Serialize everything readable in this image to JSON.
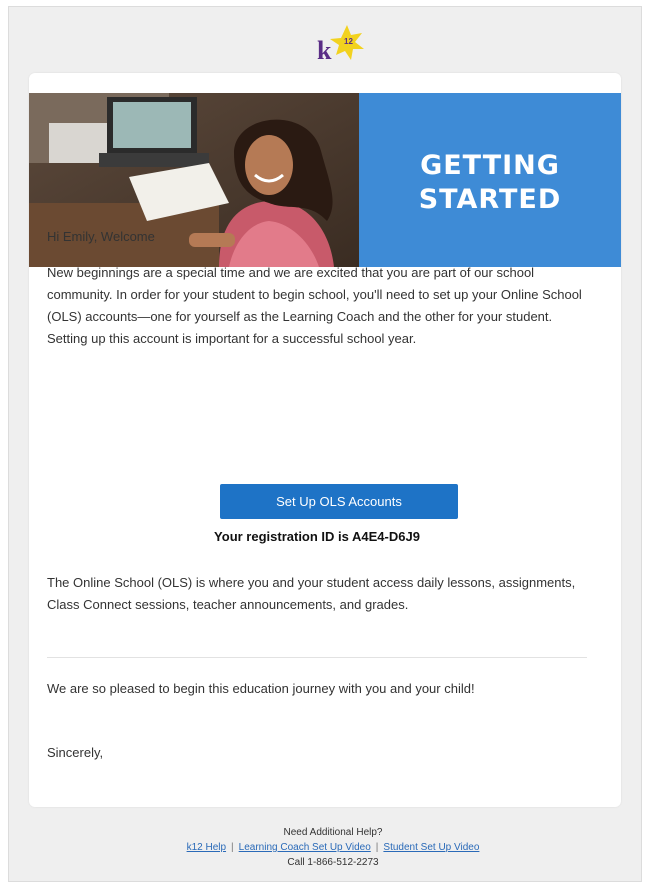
{
  "logo_text": "k12",
  "hero": {
    "title_line1": "GETTING",
    "title_line2": "STARTED"
  },
  "email": {
    "greeting": "Hi Emily, Welcome",
    "paragraph1": "New beginnings are a special time and we are excited that you are part of our school community. In order for your student to begin school, you'll need to set up your Online School (OLS) accounts—one for yourself as the Learning Coach and the other for your student. Setting up this account is important for a successful school year.",
    "cta_label": "Set Up OLS Accounts",
    "registration": "Your registration ID is A4E4-D6J9",
    "paragraph2": "The Online School (OLS) is where you and your student access daily lessons, assignments, Class Connect sessions, teacher announcements, and grades.",
    "paragraph3": "We are so pleased to begin this education journey with you and your child!",
    "signoff": "Sincerely,"
  },
  "footer": {
    "help_title": "Need Additional Help?",
    "links": [
      "k12 Help",
      "Learning Coach Set Up Video",
      "Student Set Up Video"
    ],
    "separator": "|",
    "phone": "Call 1-866-512-2273"
  },
  "colors": {
    "banner": "#3e8bd6",
    "button": "#1e73c6",
    "link": "#2a6ab8",
    "background": "#efefef"
  }
}
